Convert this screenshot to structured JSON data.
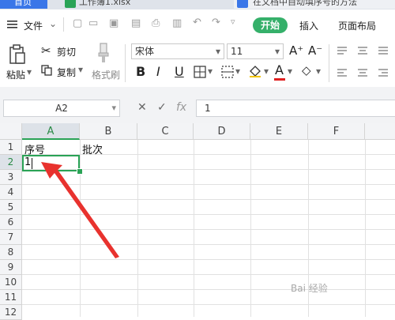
{
  "tabs": {
    "home": "首页",
    "doc1": "工作簿1.xlsx",
    "doc2": "在文档中自动填序号的方法"
  },
  "menubar": {
    "file": "文件",
    "tabs": [
      "开始",
      "插入",
      "页面布局"
    ]
  },
  "ribbon": {
    "paste": "粘贴",
    "cut": "剪切",
    "copy": "复制",
    "format_painter": "格式刷",
    "font_name": "宋体",
    "font_size": "11",
    "bold": "B",
    "italic": "I",
    "underline": "U",
    "font_color_letter": "A"
  },
  "formula_bar": {
    "name_box": "A2",
    "fx": "fx",
    "value": "1"
  },
  "sheet": {
    "columns": [
      "A",
      "B",
      "C",
      "D",
      "E",
      "F"
    ],
    "rows": [
      "1",
      "2",
      "3",
      "4",
      "5",
      "6",
      "7",
      "8",
      "9",
      "10",
      "11",
      "12"
    ],
    "cells": {
      "A1": "序号",
      "B1": "批次",
      "A2": "1"
    },
    "active_cell": "A2"
  },
  "watermark": "Bai 经验",
  "colors": {
    "accent_green": "#2aa356",
    "start_tab": "#35b06a",
    "annotation_arrow": "#e8322e"
  }
}
